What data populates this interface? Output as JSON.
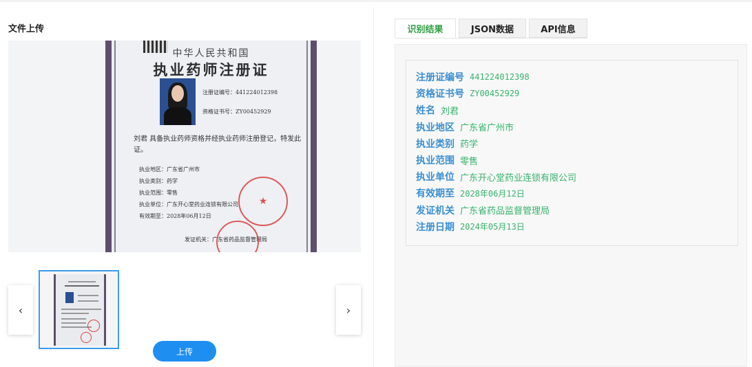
{
  "left": {
    "title": "文件上传",
    "upload_label": "上传",
    "prev_icon": "‹",
    "next_icon": "›",
    "certificate": {
      "country": "中华人民共和国",
      "title": "执业药师注册证",
      "reg_no_label": "注册证编号：",
      "reg_no": "441224012398",
      "qual_no_label": "资格证书号：",
      "qual_no": "ZY00452929",
      "statement": "刘君 具备执业药师资格并经执业药师注册登记，特发此证。",
      "fields": [
        {
          "label": "执业地区：",
          "value": "广东省广州市"
        },
        {
          "label": "执业类别：",
          "value": "药学"
        },
        {
          "label": "执业范围：",
          "value": "零售"
        },
        {
          "label": "执业单位：",
          "value": "广东开心堂药业连锁有限公司"
        },
        {
          "label": "有效期至：",
          "value": "2028年06月12日"
        }
      ],
      "issuer_label": "发证机关：",
      "issuer": "广东省药品监督管理局"
    }
  },
  "tabs": [
    {
      "label": "识别结果",
      "active": true
    },
    {
      "label": "JSON数据",
      "active": false
    },
    {
      "label": "API信息",
      "active": false
    }
  ],
  "result": [
    {
      "key": "注册证编号",
      "value": "441224012398"
    },
    {
      "key": "资格证书号",
      "value": "ZY00452929"
    },
    {
      "key": "姓名",
      "value": "刘君"
    },
    {
      "key": "执业地区",
      "value": "广东省广州市"
    },
    {
      "key": "执业类别",
      "value": "药学"
    },
    {
      "key": "执业范围",
      "value": "零售"
    },
    {
      "key": "执业单位",
      "value": "广东开心堂药业连锁有限公司"
    },
    {
      "key": "有效期至",
      "value": "2028年06月12日"
    },
    {
      "key": "发证机关",
      "value": "广东省药品监督管理局"
    },
    {
      "key": "注册日期",
      "value": "2024年05月13日"
    }
  ],
  "colors": {
    "accent_blue": "#1f8ef1",
    "key_blue": "#3b8fd0",
    "value_green": "#37b26c",
    "tab_active_green": "#2f9e44"
  }
}
